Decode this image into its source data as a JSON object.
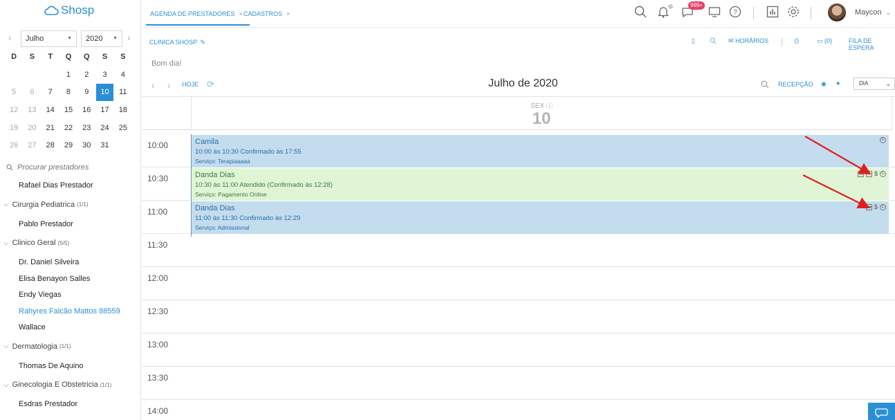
{
  "brand": {
    "name": "Shosp",
    "color": "#2b8fd6"
  },
  "mini_calendar": {
    "month": "Julho",
    "year": "2020",
    "weekday_headers": [
      "D",
      "S",
      "T",
      "Q",
      "Q",
      "S",
      "S"
    ],
    "weeks": [
      [
        "",
        "",
        "",
        "1",
        "2",
        "3",
        "4"
      ],
      [
        "5",
        "6",
        "7",
        "8",
        "9",
        "10",
        "11"
      ],
      [
        "12",
        "13",
        "14",
        "15",
        "16",
        "17",
        "18"
      ],
      [
        "19",
        "20",
        "21",
        "22",
        "23",
        "24",
        "25"
      ],
      [
        "26",
        "27",
        "28",
        "29",
        "30",
        "31",
        ""
      ]
    ],
    "selected_day": "10"
  },
  "provider_search": {
    "placeholder": "Procurar prestadores"
  },
  "providers": {
    "top": "Rafael Dias Prestador",
    "groups": [
      {
        "name": "Cirurgia Pediatrica",
        "count": "(1/1)",
        "members": [
          "Pablo Prestador"
        ]
      },
      {
        "name": "Clinico Geral",
        "count": "(5/5)",
        "members": [
          "Dr. Daniel Silveira",
          "Elisa Benayon Salles",
          "Endy Viegas",
          "Rahyres Falcão Mattos 88559",
          "Wallace"
        ]
      },
      {
        "name": "Dermatologia",
        "count": "(1/1)",
        "members": [
          "Thomas De Aquino"
        ]
      },
      {
        "name": "Ginecologia E Obstetricia",
        "count": "(1/1)",
        "members": [
          "Esdras Prestador"
        ]
      }
    ]
  },
  "tabs": [
    {
      "label": "AGENDA DE PRESTADORES",
      "close": "×"
    },
    {
      "label": "CADASTROS",
      "close": "×"
    }
  ],
  "header": {
    "messages_badge": "999+",
    "user_name": "Maycon"
  },
  "toolbar": {
    "clinic_name": "CLINICA SHOSP",
    "horarios_label": "HORÁRIOS",
    "waitlist_count": "(0)",
    "waitlist_label": "FILA DE ESPERA",
    "greeting": "Bom dia!",
    "today_label": "HOJE",
    "month_title": "Julho de 2020",
    "reception_label": "RECEPÇÃO",
    "view_select": "DIA"
  },
  "day_view": {
    "weekday": "SEX",
    "day": "10",
    "time_slots": [
      "10:00",
      "10:30",
      "11:00",
      "11:30",
      "12:00",
      "12:30",
      "13:00",
      "13:30",
      "14:00"
    ]
  },
  "events": [
    {
      "name": "Camila",
      "time": "10:00 às 10:30 Confirmado às 17:55",
      "service": "Serviço: Terapiaaaaa",
      "color": "#c3dcee"
    },
    {
      "name": "Danda Dias",
      "time": "10:30 às 11:00 Atendido (Confirmado às 12:28)",
      "service": "Serviço: Pagamento Online",
      "color": "#dff5d5"
    },
    {
      "name": "Danda Dias",
      "time": "11:00 às 11:30 Confirmado às 12:29",
      "service": "Serviço: Admissional",
      "color": "#c3dcee"
    }
  ],
  "colors": {
    "accent": "#2b8fd6",
    "annotation_arrow": "#e02020",
    "badge": "#e83e6c"
  }
}
